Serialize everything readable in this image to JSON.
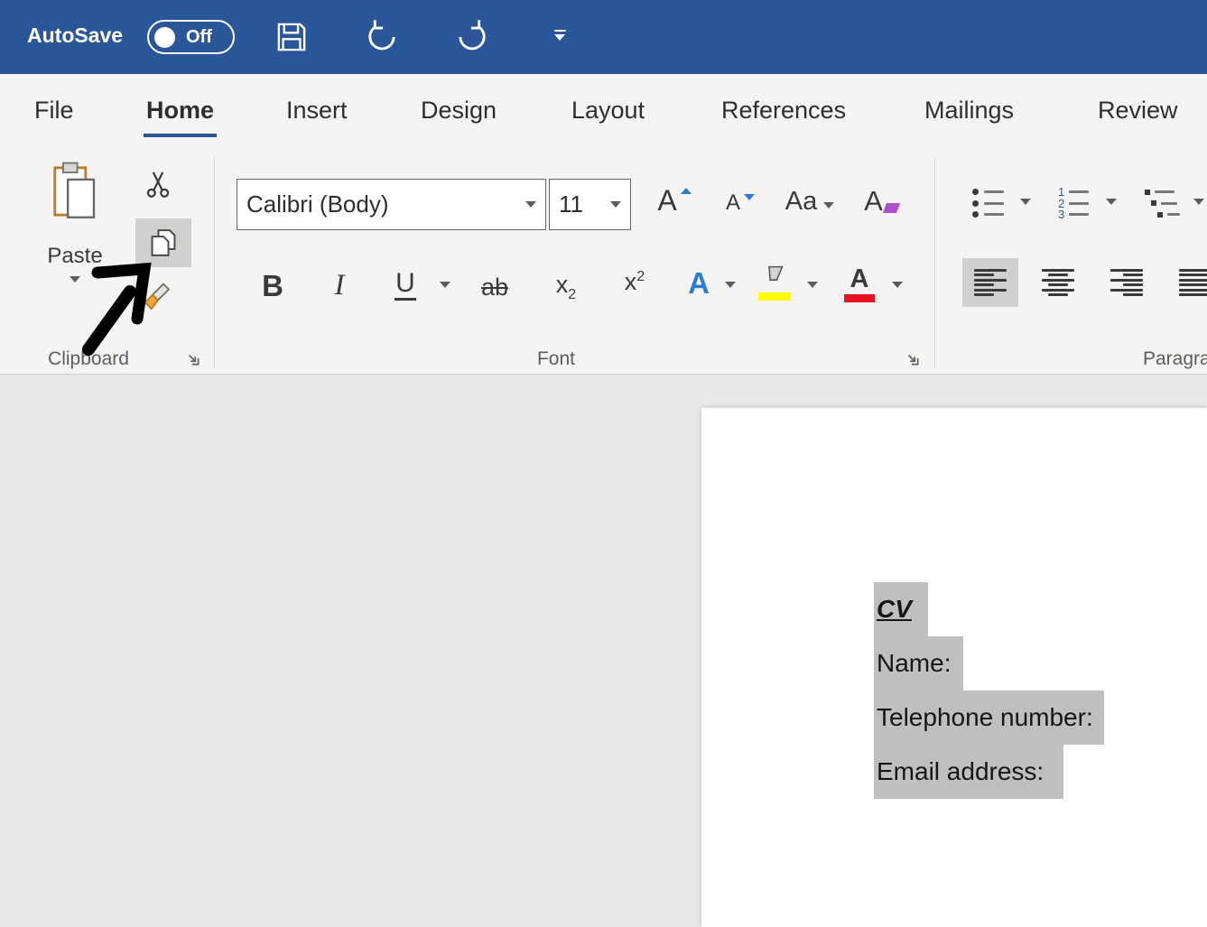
{
  "titlebar": {
    "autosave_label": "AutoSave",
    "autosave_state": "Off"
  },
  "tabs": [
    {
      "label": "File"
    },
    {
      "label": "Home"
    },
    {
      "label": "Insert"
    },
    {
      "label": "Design"
    },
    {
      "label": "Layout"
    },
    {
      "label": "References"
    },
    {
      "label": "Mailings"
    },
    {
      "label": "Review"
    }
  ],
  "ribbon": {
    "clipboard": {
      "label": "Clipboard",
      "paste_label": "Paste"
    },
    "font": {
      "label": "Font",
      "font_name": "Calibri (Body)",
      "font_size": "11",
      "grow_font": "A",
      "shrink_font": "A",
      "change_case": "Aa",
      "clear_format": "A",
      "bold": "B",
      "italic": "I",
      "underline": "U",
      "strikethrough": "ab",
      "subscript_base": "x",
      "subscript_mark": "2",
      "superscript_base": "x",
      "superscript_mark": "2",
      "text_effects": "A",
      "font_color": "A"
    },
    "paragraph": {
      "label": "Paragraph",
      "numbering_digits": [
        "1",
        "2",
        "3"
      ]
    }
  },
  "document": {
    "lines": [
      {
        "text": "CV"
      },
      {
        "text": "Name:"
      },
      {
        "text": "Telephone number:"
      },
      {
        "text": "Email address:"
      }
    ]
  },
  "colors": {
    "titlebar_blue": "#2b579a",
    "accent": "#2b579a",
    "selection_gray": "#bfbfbf",
    "highlight_yellow": "#ffff00",
    "font_color_red": "#e81123",
    "effects_blue": "#2b7cd3"
  }
}
